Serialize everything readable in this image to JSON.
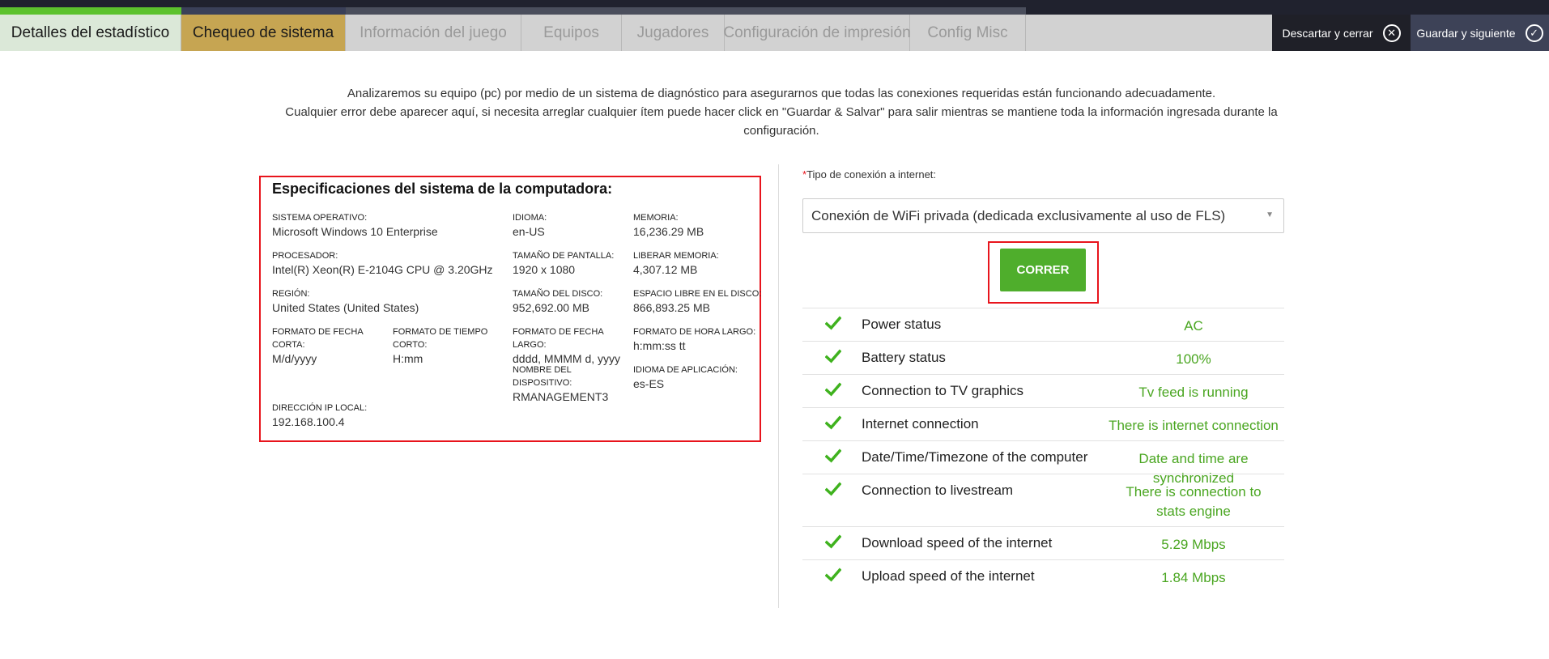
{
  "tabs": [
    {
      "label": "Detalles del estadístico",
      "state": "done"
    },
    {
      "label": "Chequeo de sistema",
      "state": "active"
    },
    {
      "label": "Información del juego",
      "state": "inactive"
    },
    {
      "label": "Equipos",
      "state": "inactive"
    },
    {
      "label": "Jugadores",
      "state": "inactive"
    },
    {
      "label": "Configuración de impresión",
      "state": "inactive"
    },
    {
      "label": "Config Misc",
      "state": "inactive"
    }
  ],
  "actions": {
    "discard_label": "Descartar y cerrar",
    "save_label": "Guardar y siguiente"
  },
  "intro": {
    "line1": "Analizaremos su equipo (pc) por medio de un sistema de diagnóstico para asegurarnos que todas las conexiones requeridas están funcionando adecuadamente.",
    "line2": "Cualquier error debe aparecer aquí, si necesita arreglar cualquier ítem puede hacer click en \"Guardar & Salvar\" para salir mientras se mantiene toda la información ingresada durante la configuración."
  },
  "specs": {
    "title": "Especificaciones del sistema de la computadora:",
    "os": {
      "label": "SISTEMA OPERATIVO:",
      "value": "Microsoft Windows 10 Enterprise"
    },
    "language": {
      "label": "IDIOMA:",
      "value": "en-US"
    },
    "memory": {
      "label": "MEMORIA:",
      "value": "16,236.29 MB"
    },
    "processor": {
      "label": "PROCESADOR:",
      "value": "Intel(R) Xeon(R) E-2104G CPU @ 3.20GHz"
    },
    "screen": {
      "label": "TAMAÑO DE PANTALLA:",
      "value": "1920 x 1080"
    },
    "free_memory": {
      "label": "LIBERAR MEMORIA:",
      "value": "4,307.12 MB"
    },
    "region": {
      "label": "REGIÓN:",
      "value": "United States (United States)"
    },
    "disk_size": {
      "label": "TAMAÑO DEL DISCO:",
      "value": "952,692.00 MB"
    },
    "disk_free": {
      "label": "ESPACIO LIBRE EN EL DISCO:",
      "value": "866,893.25 MB"
    },
    "short_date": {
      "label": "FORMATO DE FECHA CORTA:",
      "value": "M/d/yyyy"
    },
    "short_time": {
      "label": "FORMATO DE TIEMPO CORTO:",
      "value": "H:mm"
    },
    "long_date": {
      "label": "FORMATO DE FECHA LARGO:",
      "value": "dddd, MMMM d, yyyy"
    },
    "long_time": {
      "label": "FORMATO DE HORA LARGO:",
      "value": "h:mm:ss tt"
    },
    "device_name": {
      "label": "NOMBRE DEL DISPOSITIVO:",
      "value": "RMANAGEMENT3"
    },
    "app_language": {
      "label": "IDIOMA DE APLICACIÓN:",
      "value": "es-ES"
    },
    "local_ip": {
      "label": "DIRECCIÓN IP LOCAL:",
      "value": "192.168.100.4"
    }
  },
  "connection": {
    "required_mark": "*",
    "label": "Tipo de conexión a internet:",
    "selected": "Conexión de WiFi privada (dedicada exclusivamente al uso de FLS)"
  },
  "run_button": "CORRER",
  "checks": [
    {
      "label": "Power status",
      "status": "AC"
    },
    {
      "label": "Battery status",
      "status": "100%"
    },
    {
      "label": "Connection to TV graphics",
      "status": "Tv feed is running"
    },
    {
      "label": "Internet connection",
      "status": "There is internet connection"
    },
    {
      "label": "Date/Time/Timezone of the computer",
      "status": "Date and time are synchronized"
    },
    {
      "label": "Connection to livestream",
      "status": "There is connection to stats engine"
    },
    {
      "label": "Download speed of the internet",
      "status": "5.29 Mbps"
    },
    {
      "label": "Upload speed of the internet",
      "status": "1.84 Mbps"
    }
  ],
  "colors": {
    "accent_green": "#4fae2c",
    "active_tab": "#c6a552",
    "status_green": "#4aa621",
    "highlight_red": "#e8141c"
  }
}
